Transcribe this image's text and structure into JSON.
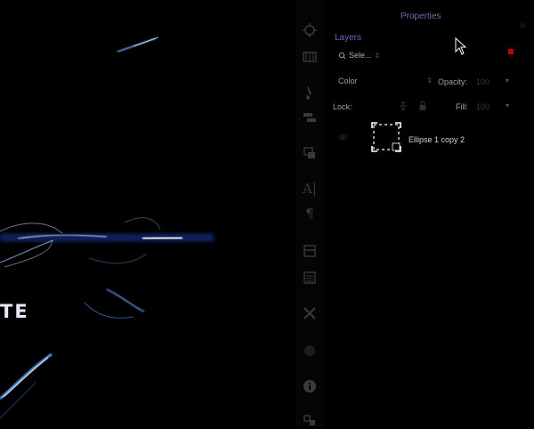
{
  "app": {
    "colors": {
      "accent": "#5f6ab5",
      "badge": "#c00000",
      "glow": "#3f79ff"
    }
  },
  "canvas": {
    "partial_text": "TE"
  },
  "toolstrip": {
    "tools": [
      {
        "icon": "history-icon"
      },
      {
        "icon": "swatches-icon"
      },
      {
        "icon": "brush-icon"
      },
      {
        "icon": "brush-presets-icon"
      },
      {
        "icon": "layer-comps-icon"
      },
      {
        "icon": "character-icon",
        "text": "A|"
      },
      {
        "icon": "paragraph-icon",
        "text": "¶"
      },
      {
        "icon": "adjustments-icon"
      },
      {
        "icon": "styles-icon"
      },
      {
        "icon": "tools-icon"
      },
      {
        "icon": "circle-icon"
      },
      {
        "icon": "info-icon"
      },
      {
        "icon": "navigator-icon"
      }
    ]
  },
  "panel": {
    "tabs": {
      "properties": "Properties",
      "layers": "Layers"
    },
    "filter": {
      "label": "Sele..."
    },
    "blend_mode": {
      "value": "Color"
    },
    "opacity": {
      "label": "Opacity:",
      "value": "100"
    },
    "lock": {
      "label": "Lock:"
    },
    "fill": {
      "label": "Fill:",
      "value": "100"
    },
    "layers": [
      {
        "name": "Ellipse 1 copy 2",
        "visible": true,
        "selected": true
      }
    ]
  }
}
